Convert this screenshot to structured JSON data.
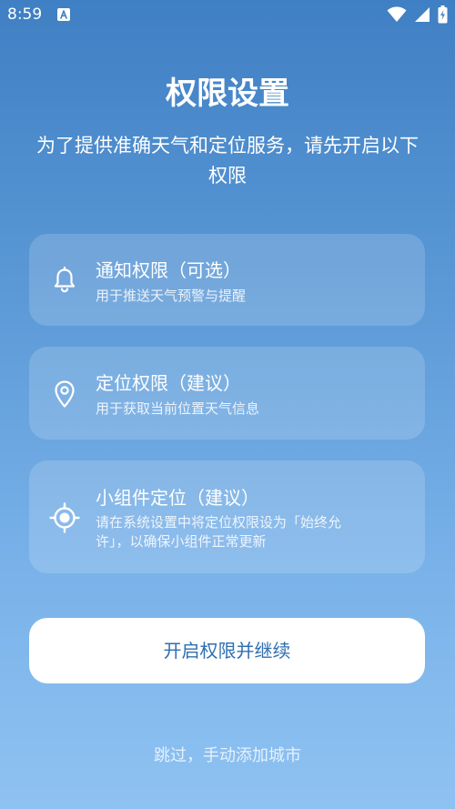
{
  "status_bar": {
    "time": "8:59",
    "icons": [
      "font-a-notification-icon",
      "wifi-icon",
      "cellular-signal-icon",
      "battery-charging-icon"
    ]
  },
  "header": {
    "title": "权限设置",
    "subtitle": "为了提供准确天气和定位服务，请先开启以下权限"
  },
  "permissions": [
    {
      "icon": "bell-icon",
      "title": "通知权限（可选）",
      "desc": "用于推送天气预警与提醒"
    },
    {
      "icon": "location-pin-icon",
      "title": "定位权限（建议）",
      "desc": "用于获取当前位置天气信息"
    },
    {
      "icon": "crosshair-icon",
      "title": "小组件定位（建议）",
      "desc": "请在系统设置中将定位权限设为「始终允许」，以确保小组件正常更新"
    }
  ],
  "actions": {
    "primary_label": "开启权限并继续",
    "skip_label": "跳过，手动添加城市"
  },
  "colors": {
    "gradient_top": "#3f7fc3",
    "gradient_bottom": "#8fc2f2",
    "button_text": "#2f6fb0",
    "button_bg": "#ffffff"
  }
}
